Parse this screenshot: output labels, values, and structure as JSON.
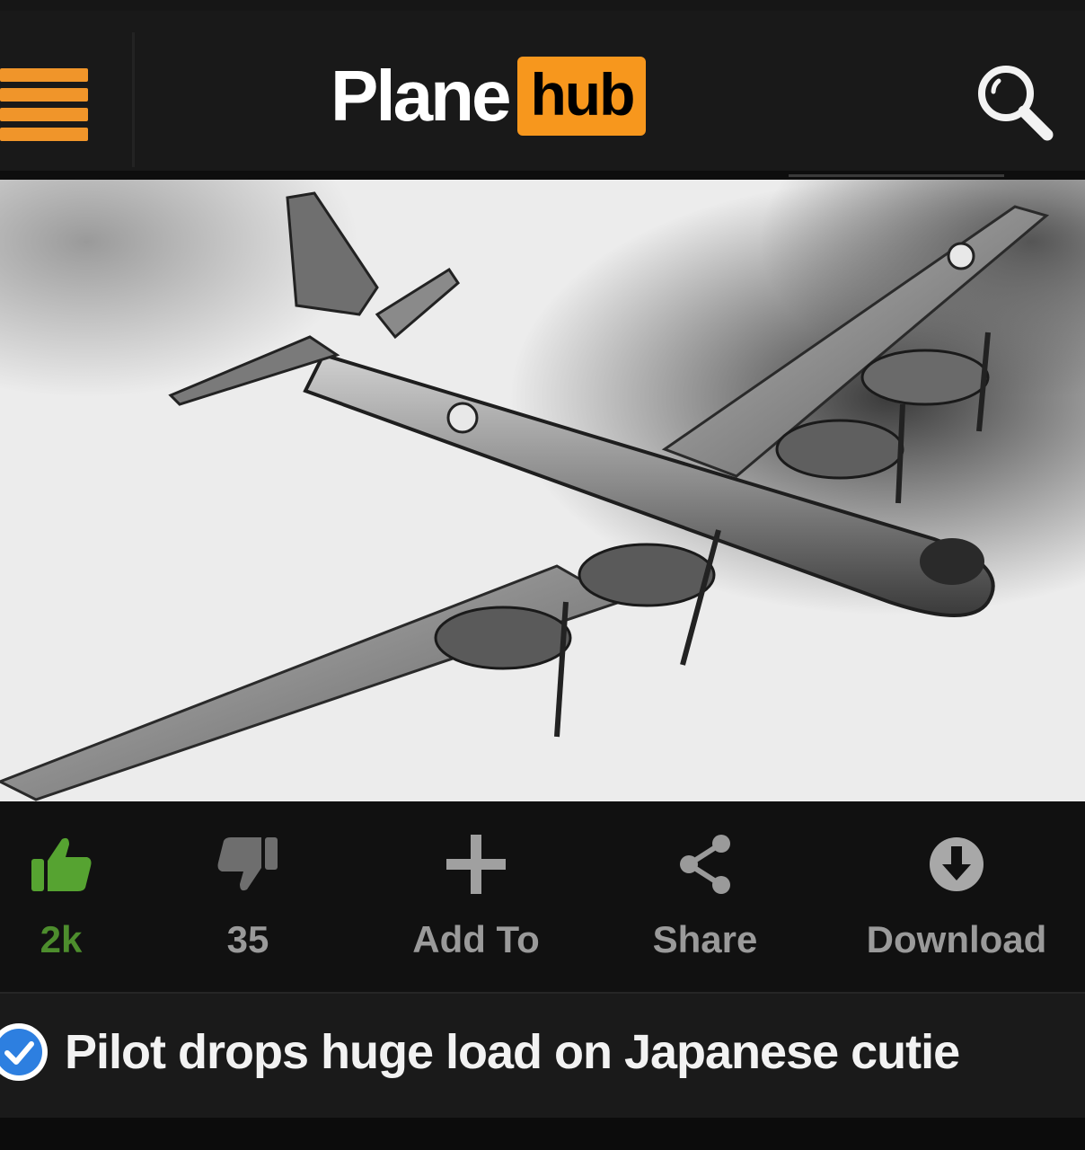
{
  "header": {
    "logo_left": "Plane",
    "logo_right": "hub",
    "menu_icon": "hamburger-menu-icon",
    "search_icon": "search-icon"
  },
  "video": {
    "thumbnail": "b29-bomber-photo"
  },
  "actions": {
    "like_count": "2k",
    "dislike_count": "35",
    "add_to_label": "Add To",
    "share_label": "Share",
    "download_label": "Download"
  },
  "title": {
    "text": "Pilot drops huge load on Japanese cutie",
    "verified_icon": "verified-check-icon"
  },
  "colors": {
    "accent": "#f7971d",
    "like_green": "#56a331",
    "verified_blue": "#2d7fe0"
  }
}
